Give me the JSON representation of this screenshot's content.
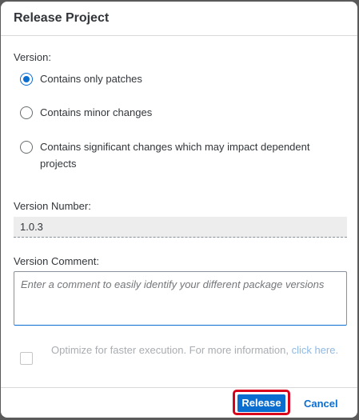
{
  "dialog": {
    "title": "Release Project"
  },
  "version": {
    "label": "Version:",
    "options": [
      {
        "label": "Contains only patches",
        "selected": true
      },
      {
        "label": "Contains minor changes",
        "selected": false
      },
      {
        "label": "Contains significant changes which may impact dependent projects",
        "selected": false
      }
    ]
  },
  "version_number": {
    "label": "Version Number:",
    "value": "1.0.3"
  },
  "version_comment": {
    "label": "Version Comment:",
    "placeholder": "Enter a comment to easily identify your different package versions"
  },
  "optimize": {
    "checked": false,
    "text": "Optimize for faster execution. For more information, ",
    "link_text": "click here."
  },
  "footer": {
    "release_label": "Release",
    "cancel_label": "Cancel"
  },
  "colors": {
    "accent": "#0a6ed1",
    "highlight_outline": "#d9001b"
  }
}
